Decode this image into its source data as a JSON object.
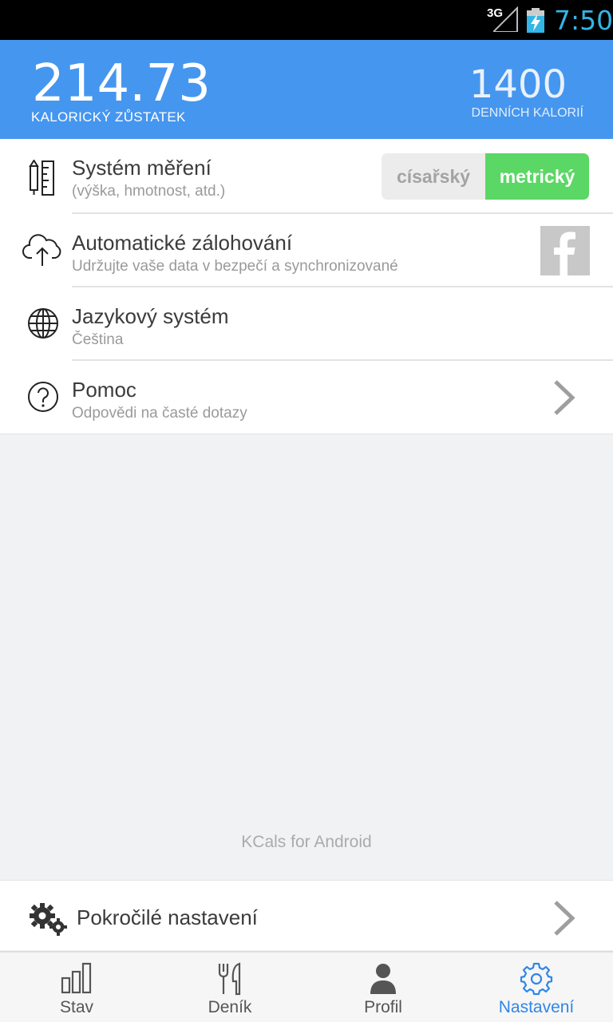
{
  "status_bar": {
    "network": "3G",
    "time": "7:50"
  },
  "header": {
    "balance_value": "214.73",
    "balance_label": "KALORICKÝ ZŮSTATEK",
    "daily_value": "1400",
    "daily_label": "DENNÍCH KALORIÍ"
  },
  "settings": [
    {
      "title": "Systém měření",
      "subtitle": "(výška, hmotnost, atd.)",
      "icon": "ruler-pencil-icon"
    },
    {
      "title": "Automatické zálohování",
      "subtitle": "Udržujte vaše data v bezpečí a synchronizované",
      "icon": "cloud-upload-icon"
    },
    {
      "title": "Jazykový systém",
      "subtitle": "Čeština",
      "icon": "globe-icon"
    },
    {
      "title": "Pomoc",
      "subtitle": "Odpovědi na časté dotazy",
      "icon": "help-icon"
    }
  ],
  "units_toggle": {
    "imperial": "císařský",
    "metric": "metrický",
    "selected": "metrický"
  },
  "footer_text": "KCals for Android",
  "advanced": {
    "title": "Pokročilé nastavení"
  },
  "nav": [
    {
      "label": "Stav",
      "icon": "bar-chart-icon"
    },
    {
      "label": "Deník",
      "icon": "fork-knife-icon"
    },
    {
      "label": "Profil",
      "icon": "person-icon"
    },
    {
      "label": "Nastavení",
      "icon": "gear-icon",
      "active": true
    }
  ],
  "colors": {
    "header": "#4596ef",
    "accent_green": "#5bd765",
    "nav_active": "#2f86e8",
    "status_time": "#33b5e5"
  }
}
